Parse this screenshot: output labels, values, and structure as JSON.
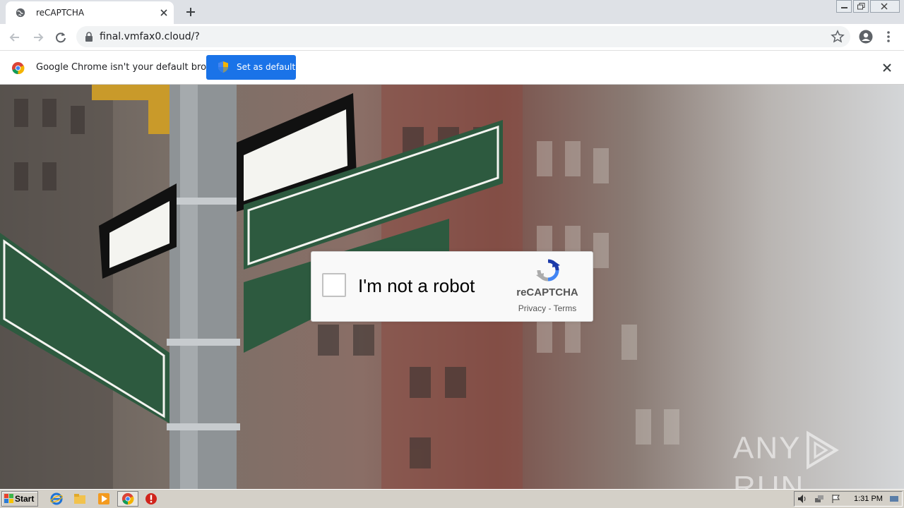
{
  "browser": {
    "tab": {
      "title": "reCAPTCHA"
    },
    "address": {
      "url": "final.vmfax0.cloud/?"
    }
  },
  "infobar": {
    "message": "Google Chrome isn't your default browser",
    "button_label": "Set as default"
  },
  "recaptcha": {
    "label": "I'm not a robot",
    "brand": "reCAPTCHA",
    "privacy": "Privacy",
    "separator": " - ",
    "terms": "Terms"
  },
  "watermark": {
    "left": "ANY",
    "right": "RUN"
  },
  "taskbar": {
    "start_label": "Start",
    "clock": "1:31 PM",
    "pinned_icons": [
      "internet-explorer-icon",
      "folder-icon",
      "media-player-icon",
      "chrome-icon",
      "security-alert-icon"
    ]
  },
  "colors": {
    "accent": "#1a73e8",
    "tabstrip": "#dee1e6",
    "taskbar": "#d4d0c8"
  }
}
